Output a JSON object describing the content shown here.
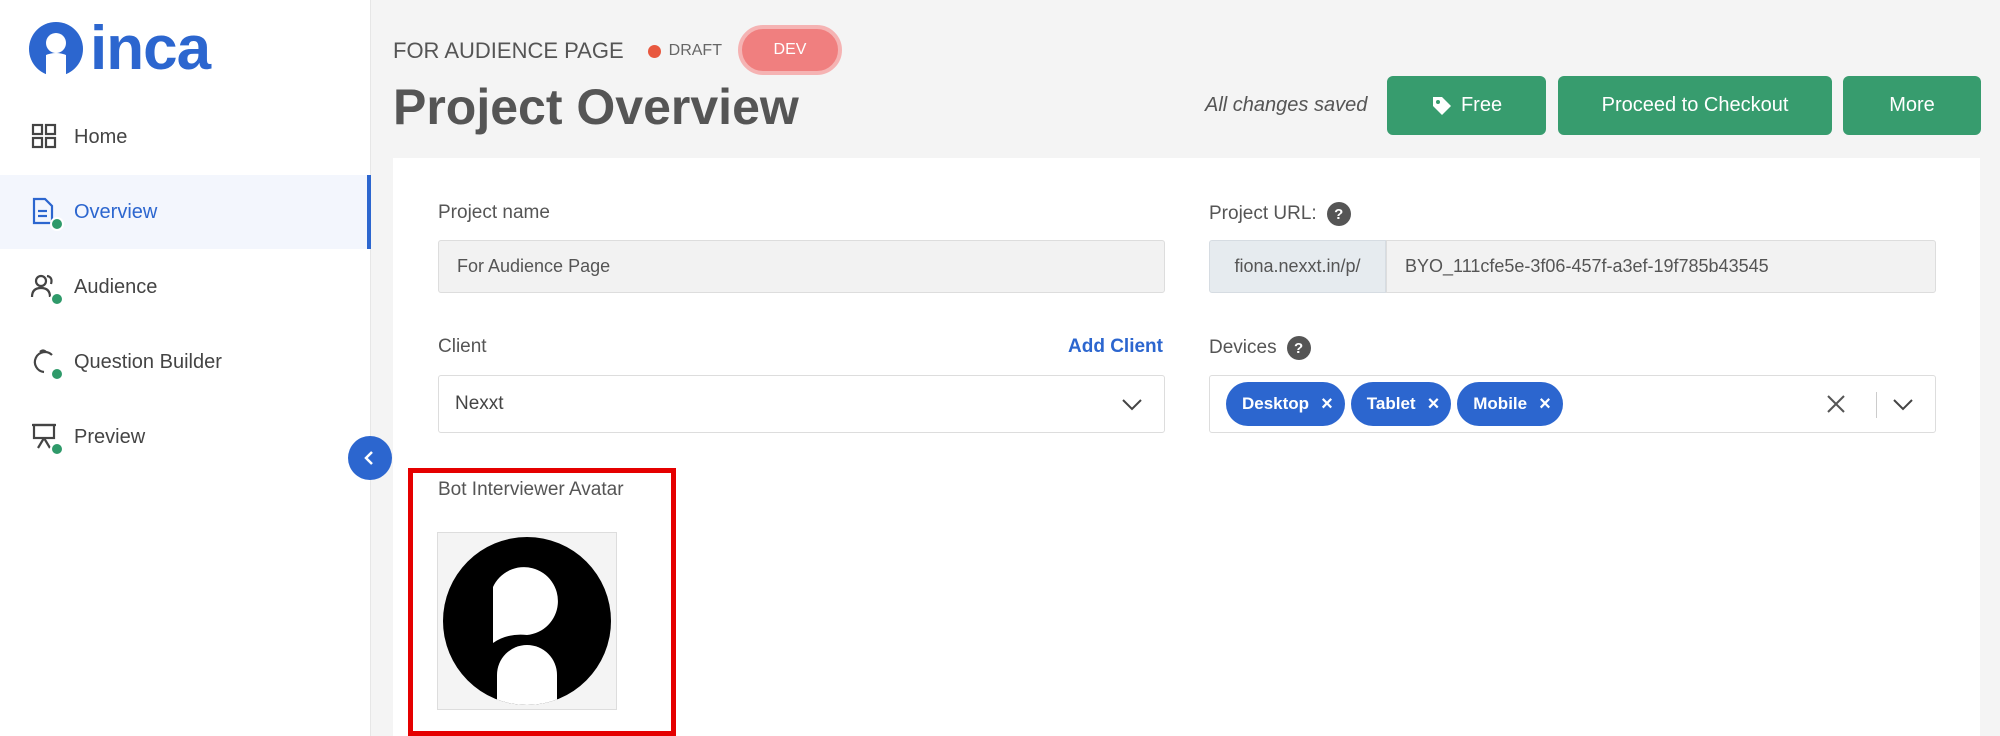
{
  "brand": {
    "name": "inca",
    "color": "#2c66cf"
  },
  "sidebar": {
    "items": [
      {
        "label": "Home",
        "icon": "grid-icon",
        "active": false
      },
      {
        "label": "Overview",
        "icon": "document-icon",
        "active": true
      },
      {
        "label": "Audience",
        "icon": "users-icon",
        "active": false
      },
      {
        "label": "Question Builder",
        "icon": "question-builder-icon",
        "active": false
      },
      {
        "label": "Preview",
        "icon": "presentation-icon",
        "active": false
      }
    ]
  },
  "header": {
    "breadcrumb": "FOR AUDIENCE PAGE",
    "status": "DRAFT",
    "env_badge": "DEV",
    "title": "Project Overview",
    "saved_text": "All changes saved",
    "buttons": {
      "free": "Free",
      "checkout": "Proceed to Checkout",
      "more": "More"
    }
  },
  "form": {
    "project_name_label": "Project name",
    "project_name_value": "For Audience Page",
    "project_url_label": "Project URL:",
    "url_prefix": "fiona.nexxt.in/p/",
    "url_value": "BYO_111cfe5e-3f06-457f-a3ef-19f785b43545",
    "client_label": "Client",
    "add_client": "Add Client",
    "client_value": "Nexxt",
    "devices_label": "Devices",
    "devices": [
      "Desktop",
      "Tablet",
      "Mobile"
    ],
    "avatar_label": "Bot Interviewer Avatar"
  },
  "colors": {
    "primary": "#2c66cf",
    "success": "#379c6e",
    "draft": "#e8583f",
    "dev": "#f07f7f",
    "highlight": "#e50000"
  }
}
